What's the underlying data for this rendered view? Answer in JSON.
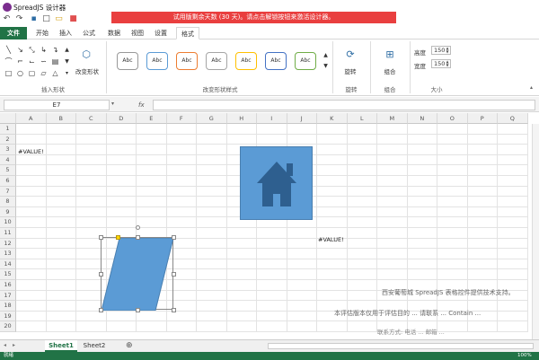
{
  "app": {
    "title": "SpreadJS 设计器"
  },
  "quick_access": [
    "undo-icon",
    "redo-icon",
    "save-icon",
    "new-file-icon",
    "open-file-icon",
    "gift-icon"
  ],
  "trial_banner": "试用版剩余天数 (30 天)。请点击解锁按钮来激活设计器。",
  "tabs": [
    {
      "label": "文件",
      "key": "file"
    },
    {
      "label": "开始",
      "key": "home"
    },
    {
      "label": "插入",
      "key": "insert"
    },
    {
      "label": "公式",
      "key": "formula"
    },
    {
      "label": "数据",
      "key": "data"
    },
    {
      "label": "视图",
      "key": "view"
    },
    {
      "label": "设置",
      "key": "settings"
    },
    {
      "label": "格式",
      "key": "format"
    }
  ],
  "ribbon": {
    "insert_shapes_label": "插入形状",
    "change_shape_label": "改变形状",
    "change_shape_style_label": "改变形状样式",
    "style_samples": [
      "Abc",
      "Abc",
      "Abc",
      "Abc",
      "Abc",
      "Abc",
      "Abc"
    ],
    "rotate_label": "旋转",
    "rotate_group": "旋转",
    "group_label": "组合",
    "group_group": "组合",
    "size_group": "大小",
    "height_label": "高度",
    "height_value": "150",
    "width_label": "宽度",
    "width_value": "150"
  },
  "namebox": "E7",
  "fx_label": "fx",
  "columns": [
    "A",
    "B",
    "C",
    "D",
    "E",
    "F",
    "G",
    "H",
    "I",
    "J",
    "K",
    "L",
    "M",
    "N",
    "O",
    "P",
    "Q"
  ],
  "rows": [
    "1",
    "2",
    "3",
    "4",
    "5",
    "6",
    "7",
    "8",
    "9",
    "10",
    "11",
    "12",
    "13",
    "14",
    "15",
    "16",
    "17",
    "18",
    "19",
    "20"
  ],
  "cells": {
    "a3": "#VALUE!",
    "k12": "#VALUE!"
  },
  "watermark": {
    "line1": "西安葡萄城 SpreadJS 表格控件提供技术支持。",
    "line2": "本评估版本仅用于评估目的 ... 请联系 ... Contain ...",
    "line3": "联系方式: 电话 ... 邮箱 ..."
  },
  "sheets": [
    "Sheet1",
    "Sheet2"
  ],
  "status": {
    "left": "就绪",
    "zoom": "100%"
  },
  "colors": {
    "accent": "#217346",
    "banner": "#e93f3f",
    "shape": "#5b9bd5"
  }
}
